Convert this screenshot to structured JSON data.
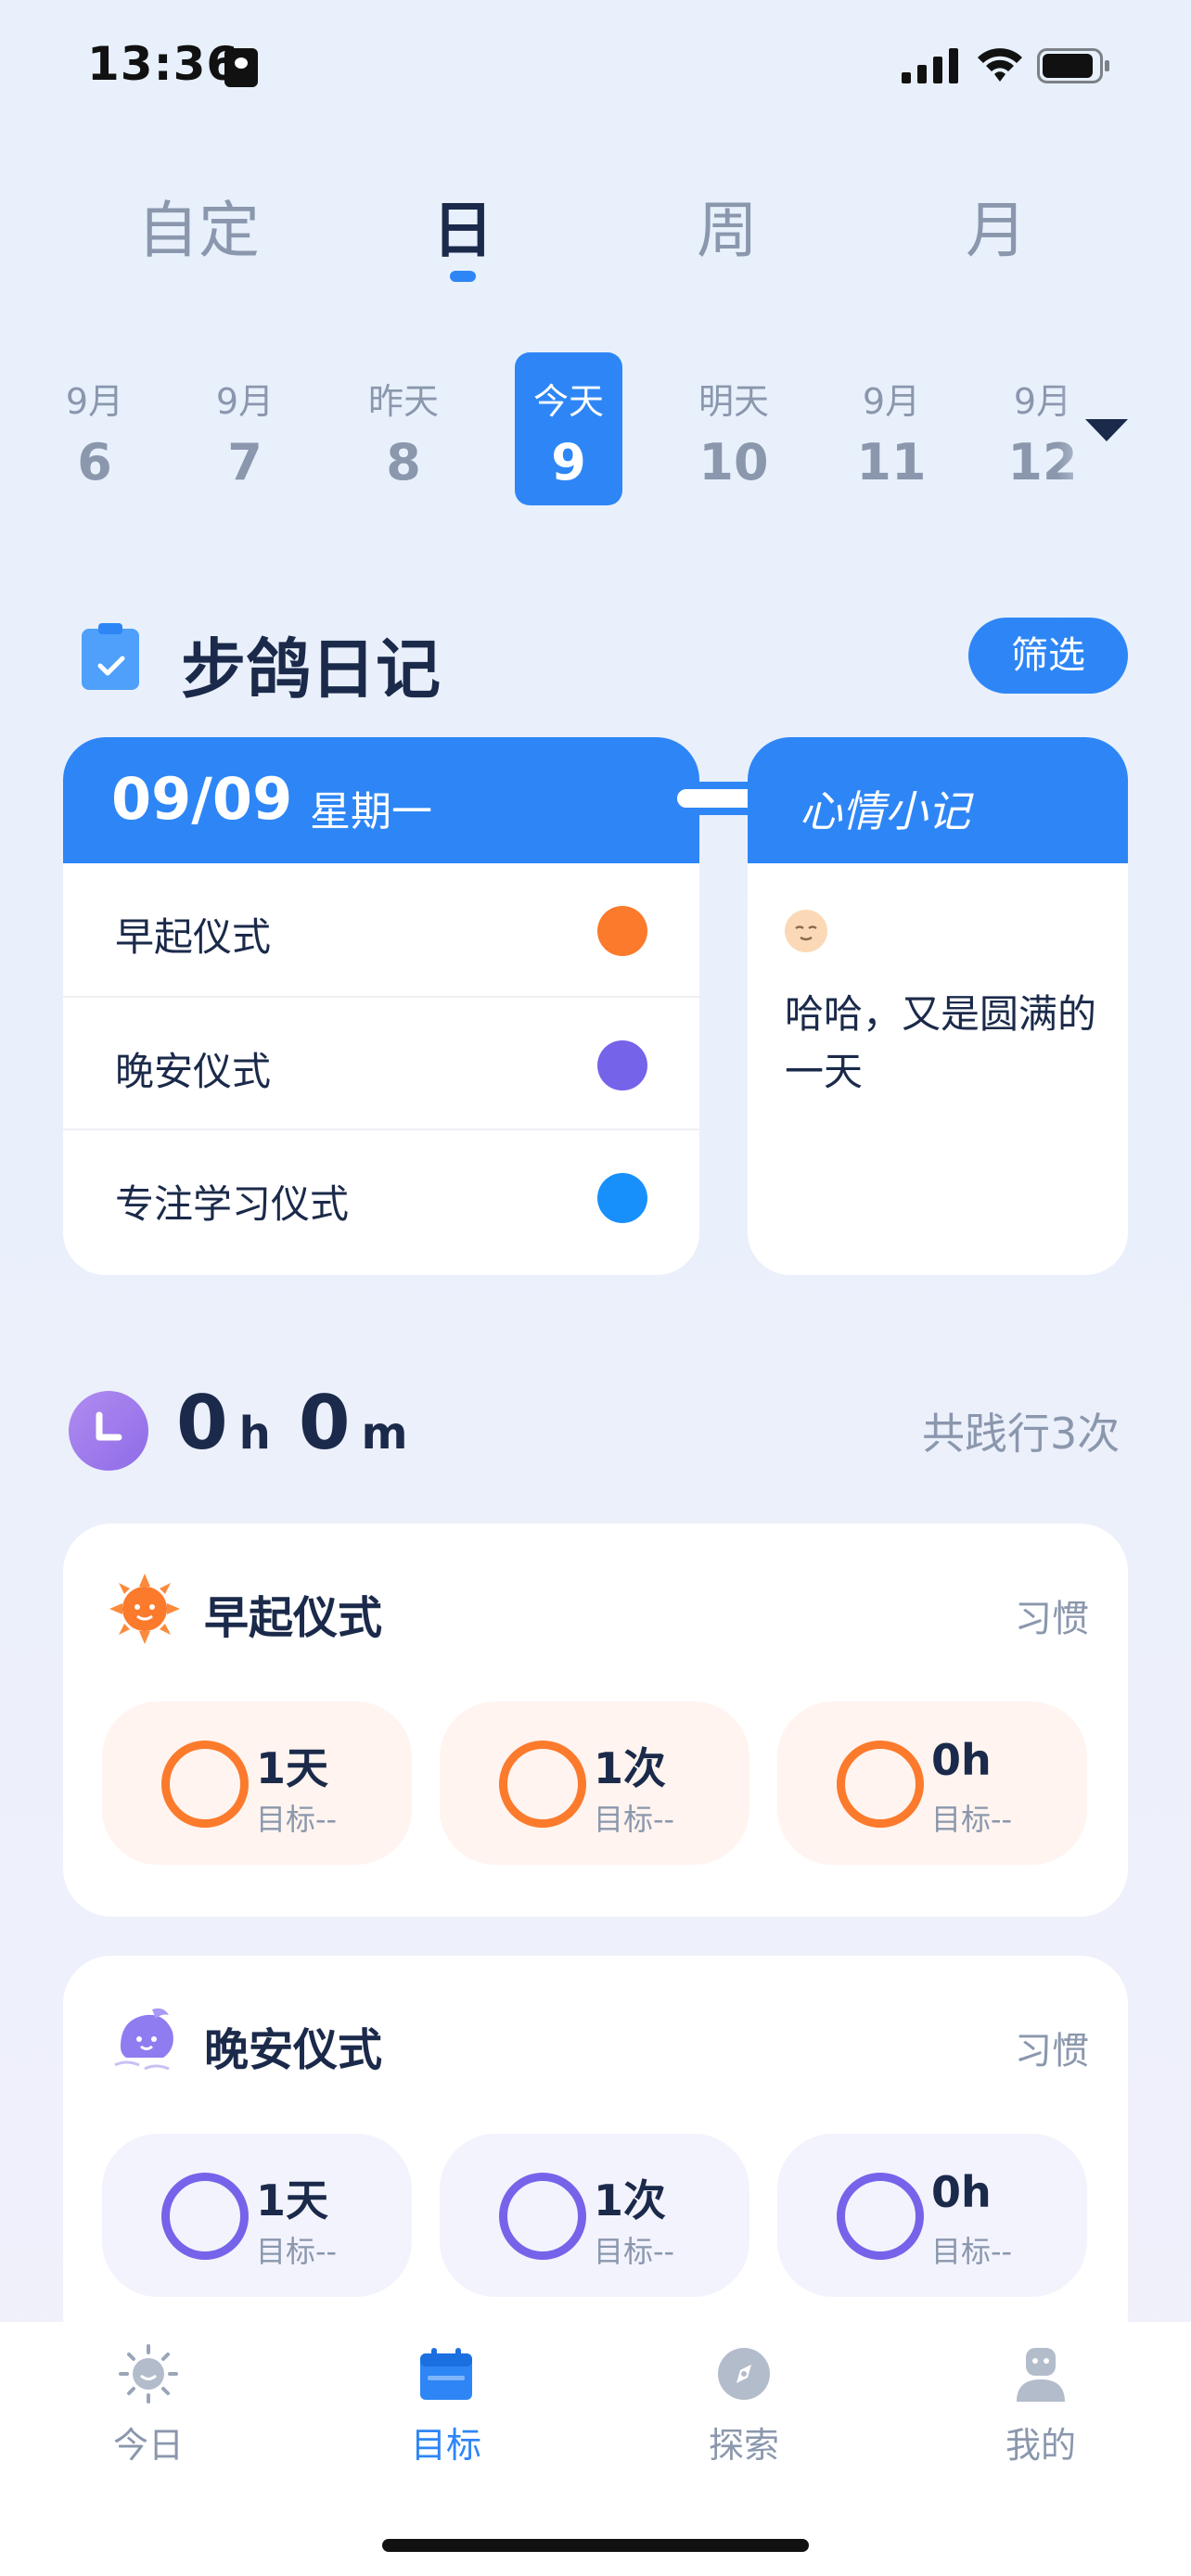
{
  "status": {
    "time": "13:36"
  },
  "tabs": [
    {
      "label": "自定"
    },
    {
      "label": "日"
    },
    {
      "label": "周"
    },
    {
      "label": "月"
    }
  ],
  "dates": [
    {
      "m": "9月",
      "d": "6"
    },
    {
      "m": "9月",
      "d": "7"
    },
    {
      "m": "昨天",
      "d": "8"
    },
    {
      "m": "今天",
      "d": "9"
    },
    {
      "m": "明天",
      "d": "10"
    },
    {
      "m": "9月",
      "d": "11"
    },
    {
      "m": "9月",
      "d": "12"
    }
  ],
  "section": {
    "title": "步鸽日记",
    "filter": "筛选"
  },
  "diary": {
    "date": "09/09",
    "weekday": "星期一",
    "rows": [
      {
        "label": "早起仪式",
        "color": "#fb7a2c"
      },
      {
        "label": "晚安仪式",
        "color": "#7563ea"
      },
      {
        "label": "专注学习仪式",
        "color": "#1890fb"
      }
    ]
  },
  "mood": {
    "title": "心情小记",
    "text": "哈哈，又是圆满的一天"
  },
  "summary": {
    "hours": "0",
    "hours_unit": "h",
    "minutes": "0",
    "minutes_unit": "m",
    "total": "共践行3次"
  },
  "rituals": [
    {
      "title": "早起仪式",
      "tag": "习惯",
      "color": "#fb7a2c",
      "bg": "#fff4ef",
      "stats": [
        {
          "value": "1天",
          "sub": "目标--"
        },
        {
          "value": "1次",
          "sub": "目标--"
        },
        {
          "value": "0h",
          "sub": "目标--"
        }
      ]
    },
    {
      "title": "晚安仪式",
      "tag": "习惯",
      "color": "#7563ea",
      "bg": "#f3f3fd",
      "stats": [
        {
          "value": "1天",
          "sub": "目标--"
        },
        {
          "value": "1次",
          "sub": "目标--"
        },
        {
          "value": "0h",
          "sub": "目标--"
        }
      ]
    }
  ],
  "nav": [
    {
      "label": "今日",
      "icon": "sun-icon"
    },
    {
      "label": "目标",
      "icon": "calendar-icon"
    },
    {
      "label": "探索",
      "icon": "compass-icon"
    },
    {
      "label": "我的",
      "icon": "profile-icon"
    }
  ],
  "colors": {
    "accent": "#2e86f6",
    "text": "#1b2a4a",
    "muted": "#8a97ad"
  }
}
